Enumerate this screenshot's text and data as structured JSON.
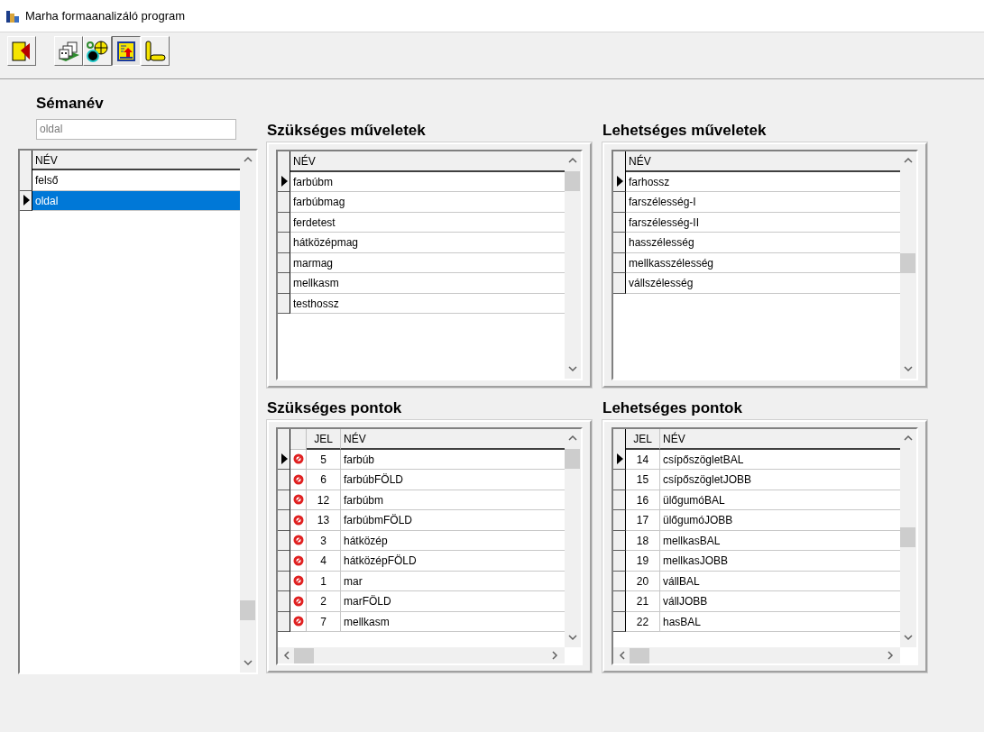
{
  "window": {
    "title": "Marha formaanalizáló program"
  },
  "toolbar": [
    {
      "pressed": false
    },
    {
      "pressed": false
    },
    {
      "pressed": false
    },
    {
      "pressed": true
    },
    {
      "pressed": false
    }
  ],
  "schema": {
    "label": "Sémanév",
    "value": "oldal",
    "grid": {
      "columns": [
        {
          "label": "NÉV"
        }
      ],
      "rows": [
        {
          "cells": [
            "felső"
          ],
          "selected": false
        },
        {
          "cells": [
            "oldal"
          ],
          "selected": true
        }
      ]
    }
  },
  "panels": [
    {
      "title": "Szükséges műveletek",
      "grid": {
        "columns": [
          {
            "label": "NÉV"
          }
        ],
        "rows": [
          {
            "cells": [
              "farbúbm"
            ],
            "selected": true
          },
          {
            "cells": [
              "farbúbmag"
            ],
            "selected": false
          },
          {
            "cells": [
              "ferdetest"
            ],
            "selected": false
          },
          {
            "cells": [
              "hátközépmag"
            ],
            "selected": false
          },
          {
            "cells": [
              "marmag"
            ],
            "selected": false
          },
          {
            "cells": [
              "mellkasm"
            ],
            "selected": false
          },
          {
            "cells": [
              "testhossz"
            ],
            "selected": false
          }
        ]
      }
    },
    {
      "title": "Lehetséges műveletek",
      "grid": {
        "columns": [
          {
            "label": "NÉV"
          }
        ],
        "rows": [
          {
            "cells": [
              "farhossz"
            ],
            "selected": true
          },
          {
            "cells": [
              "farszélesség-I"
            ],
            "selected": false
          },
          {
            "cells": [
              "farszélesség-II"
            ],
            "selected": false
          },
          {
            "cells": [
              "hasszélesség"
            ],
            "selected": false
          },
          {
            "cells": [
              "mellkasszélesség"
            ],
            "selected": false
          },
          {
            "cells": [
              "vállszélesség"
            ],
            "selected": false
          }
        ]
      }
    },
    {
      "title": "Szükséges pontok",
      "grid": {
        "hscroll": true,
        "columns": [
          {
            "label": "JEL"
          },
          {
            "label": "NÉV"
          }
        ],
        "rows": [
          {
            "flag": true,
            "cells": [
              "5",
              "farbúb"
            ],
            "selected": true
          },
          {
            "flag": true,
            "cells": [
              "6",
              "farbúbFÖLD"
            ],
            "selected": false
          },
          {
            "flag": true,
            "cells": [
              "12",
              "farbúbm"
            ],
            "selected": false
          },
          {
            "flag": true,
            "cells": [
              "13",
              "farbúbmFÖLD"
            ],
            "selected": false
          },
          {
            "flag": true,
            "cells": [
              "3",
              "hátközép"
            ],
            "selected": false
          },
          {
            "flag": true,
            "cells": [
              "4",
              "hátközépFÖLD"
            ],
            "selected": false
          },
          {
            "flag": true,
            "cells": [
              "1",
              "mar"
            ],
            "selected": false
          },
          {
            "flag": true,
            "cells": [
              "2",
              "marFÖLD"
            ],
            "selected": false
          },
          {
            "flag": true,
            "cells": [
              "7",
              "mellkasm"
            ],
            "selected": false
          }
        ]
      }
    },
    {
      "title": "Lehetséges pontok",
      "grid": {
        "hscroll": true,
        "columns": [
          {
            "label": "JEL"
          },
          {
            "label": "NÉV"
          }
        ],
        "rows": [
          {
            "cells": [
              "14",
              "csípőszögletBAL"
            ],
            "selected": true
          },
          {
            "cells": [
              "15",
              "csípőszögletJOBB"
            ],
            "selected": false
          },
          {
            "cells": [
              "16",
              "ülőgumóBAL"
            ],
            "selected": false
          },
          {
            "cells": [
              "17",
              "ülőgumóJOBB"
            ],
            "selected": false
          },
          {
            "cells": [
              "18",
              "mellkasBAL"
            ],
            "selected": false
          },
          {
            "cells": [
              "19",
              "mellkasJOBB"
            ],
            "selected": false
          },
          {
            "cells": [
              "20",
              "vállBAL"
            ],
            "selected": false
          },
          {
            "cells": [
              "21",
              "vállJOBB"
            ],
            "selected": false
          },
          {
            "cells": [
              "22",
              "hasBAL"
            ],
            "selected": false
          }
        ]
      }
    }
  ]
}
